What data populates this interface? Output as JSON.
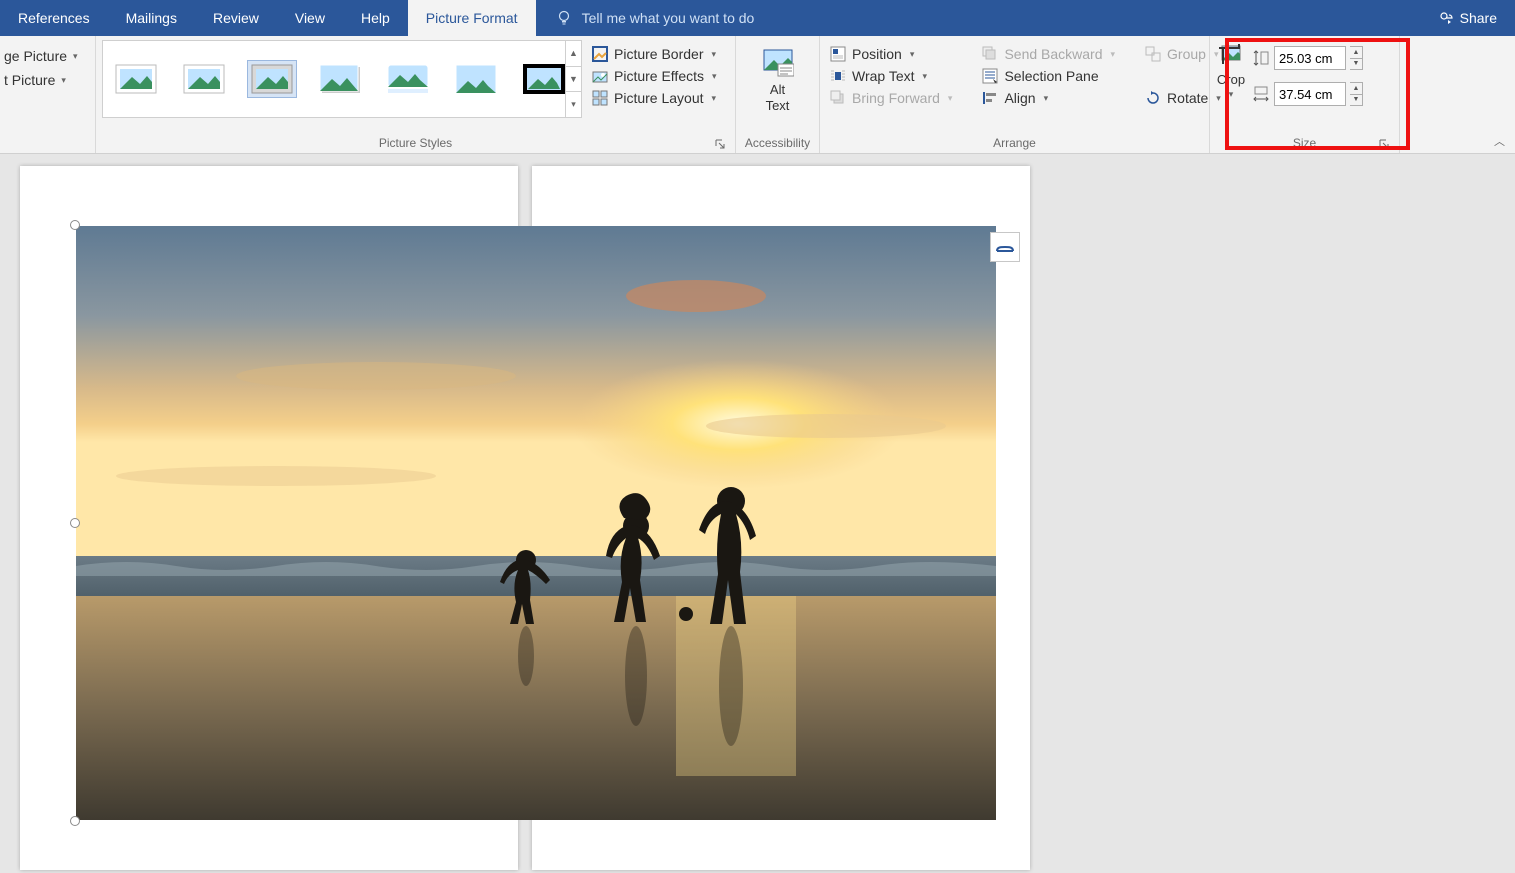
{
  "tabs": {
    "references": "References",
    "mailings": "Mailings",
    "review": "Review",
    "view": "View",
    "help": "Help",
    "picture_format": "Picture Format"
  },
  "tell_me": "Tell me what you want to do",
  "share": "Share",
  "adjust": {
    "change_picture": "ge Picture",
    "reset_picture": "t Picture"
  },
  "picture_styles": {
    "label": "Picture Styles",
    "border": "Picture Border",
    "effects": "Picture Effects",
    "layout": "Picture Layout"
  },
  "accessibility": {
    "label": "Accessibility",
    "alt_text_line1": "Alt",
    "alt_text_line2": "Text"
  },
  "arrange": {
    "label": "Arrange",
    "position": "Position",
    "wrap_text": "Wrap Text",
    "bring_forward": "Bring Forward",
    "send_backward": "Send Backward",
    "selection_pane": "Selection Pane",
    "align": "Align",
    "group": "Group",
    "rotate": "Rotate"
  },
  "size": {
    "label": "Size",
    "crop": "Crop",
    "height": "25.03 cm",
    "width": "37.54 cm"
  }
}
